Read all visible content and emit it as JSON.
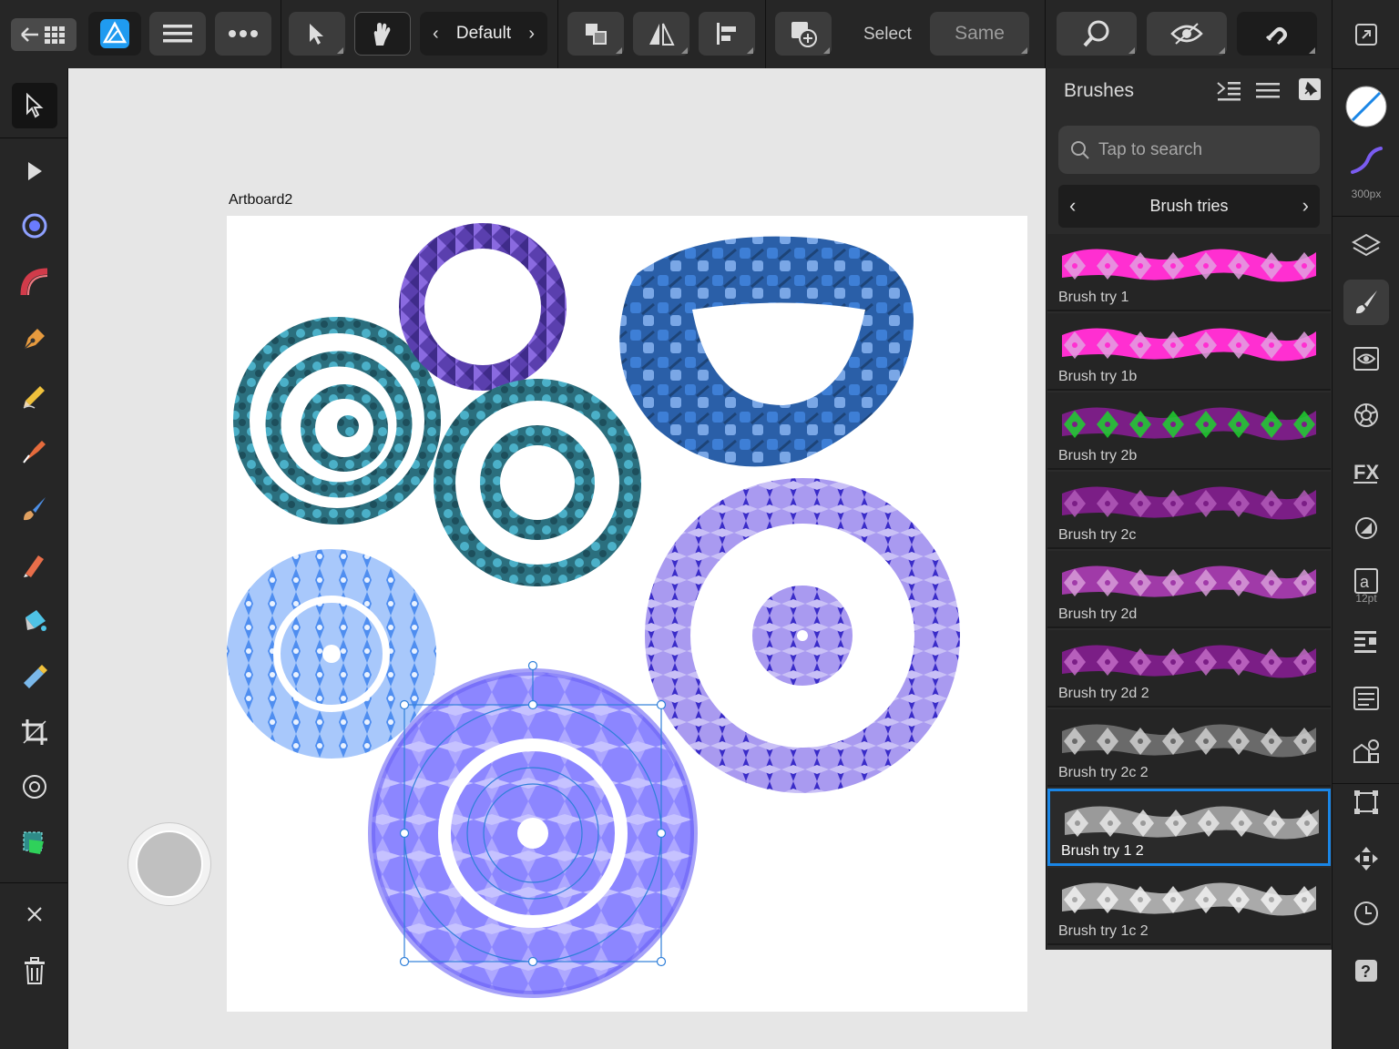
{
  "toolbar": {
    "persona_label": "Default",
    "select_label": "Select",
    "same_label": "Same"
  },
  "canvas": {
    "artboard_name": "Artboard2"
  },
  "brushes_panel": {
    "title": "Brushes",
    "search_placeholder": "Tap to search",
    "category": "Brush tries",
    "items": [
      {
        "name": "Brush try 1",
        "fill": "#ff2fd1",
        "alt": "#e39fe0",
        "selected": false
      },
      {
        "name": "Brush try 1b",
        "fill": "#ff2fd1",
        "alt": "#e39fe0",
        "selected": false
      },
      {
        "name": "Brush try 2b",
        "fill": "#7b1e86",
        "alt": "#1fd12f",
        "selected": false
      },
      {
        "name": "Brush try 2c",
        "fill": "#7b1e86",
        "alt": "#b25ab8",
        "selected": false
      },
      {
        "name": "Brush try 2d",
        "fill": "#a03aa8",
        "alt": "#d79bd8",
        "selected": false
      },
      {
        "name": "Brush try 2d 2",
        "fill": "#7b1e86",
        "alt": "#c26bc6",
        "selected": false
      },
      {
        "name": "Brush try 2c 2",
        "fill": "#6a6a6a",
        "alt": "#cfcfcf",
        "selected": false
      },
      {
        "name": "Brush try 1 2",
        "fill": "#9a9a9a",
        "alt": "#e8e8e8",
        "selected": true
      },
      {
        "name": "Brush try 1c 2",
        "fill": "#aaaaaa",
        "alt": "#f2f2f2",
        "selected": false
      }
    ]
  },
  "context_strip": {
    "stroke_width": "300px",
    "font_size": "12pt"
  }
}
